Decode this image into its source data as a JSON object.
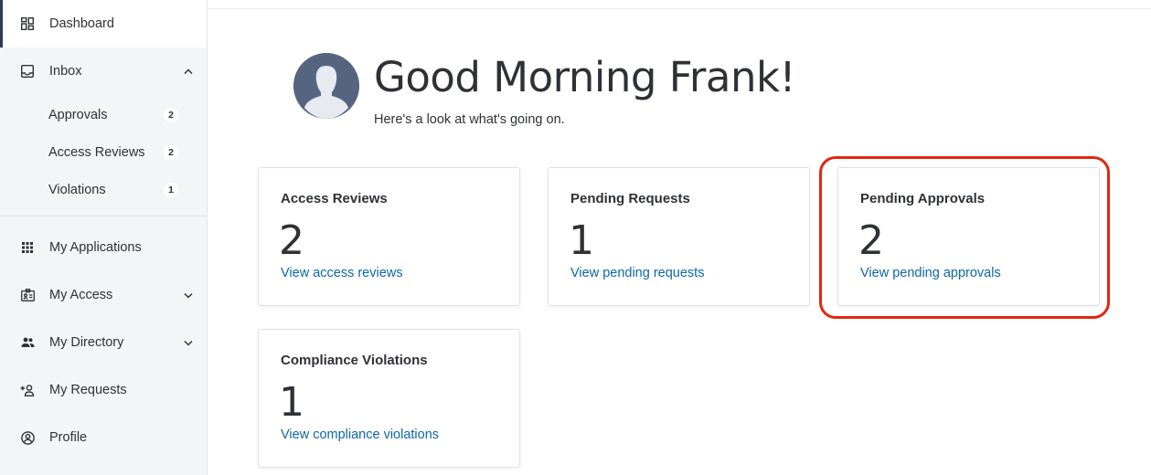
{
  "sidebar": {
    "dashboard": {
      "label": "Dashboard",
      "icon": "dashboard-grid-icon"
    },
    "inbox": {
      "label": "Inbox",
      "icon": "inbox-tray-icon",
      "expanded": true,
      "children": [
        {
          "label": "Approvals",
          "count": "2"
        },
        {
          "label": "Access Reviews",
          "count": "2"
        },
        {
          "label": "Violations",
          "count": "1"
        }
      ]
    },
    "items": [
      {
        "label": "My Applications",
        "icon": "apps-grid-icon",
        "has_chevron": false
      },
      {
        "label": "My Access",
        "icon": "id-badge-icon",
        "has_chevron": true
      },
      {
        "label": "My Directory",
        "icon": "people-icon",
        "has_chevron": true
      },
      {
        "label": "My Requests",
        "icon": "add-person-icon",
        "has_chevron": false
      },
      {
        "label": "Profile",
        "icon": "user-circle-icon",
        "has_chevron": false
      }
    ]
  },
  "header": {
    "greeting": "Good Morning Frank!",
    "subtitle": "Here's a look at what's going on."
  },
  "cards": [
    {
      "title": "Access Reviews",
      "count": "2",
      "link": "View access reviews"
    },
    {
      "title": "Pending Requests",
      "count": "1",
      "link": "View pending requests"
    },
    {
      "title": "Pending Approvals",
      "count": "2",
      "link": "View pending approvals",
      "highlighted": true
    },
    {
      "title": "Compliance Violations",
      "count": "1",
      "link": "View compliance violations"
    }
  ],
  "colors": {
    "link": "#0b67a9",
    "highlight": "#e3260f",
    "sidebar_bg": "#f4f5f7",
    "avatar_bg": "#56657f"
  }
}
